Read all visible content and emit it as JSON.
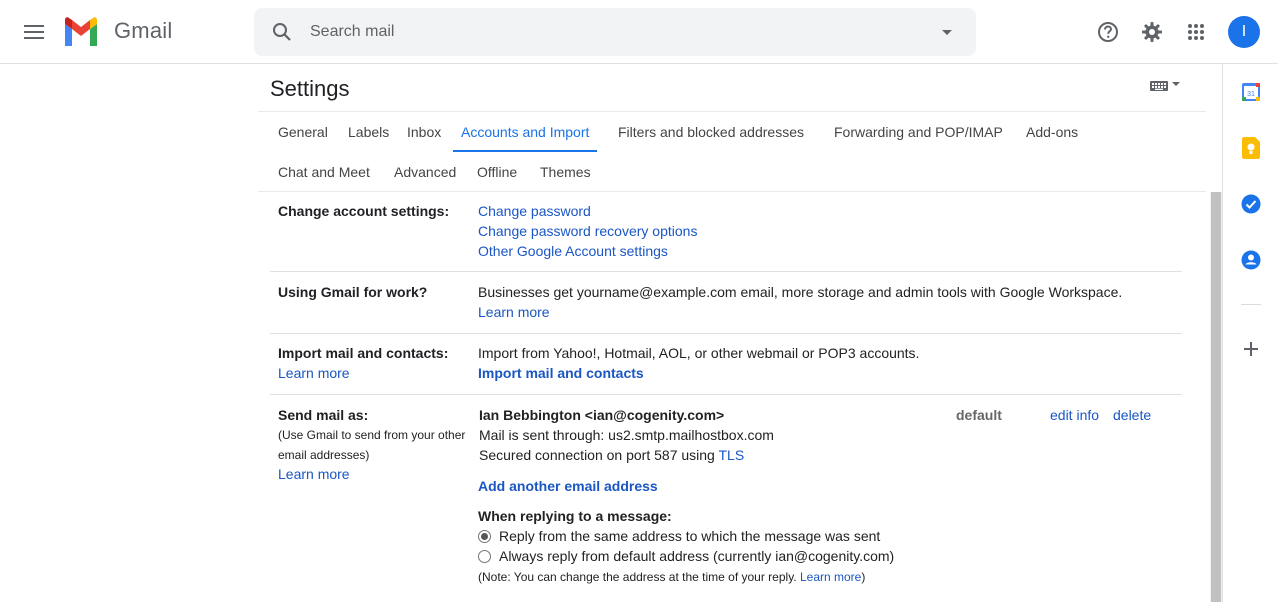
{
  "app": {
    "name": "Gmail"
  },
  "header": {
    "search_placeholder": "Search mail",
    "avatar_initial": "I"
  },
  "settings": {
    "title": "Settings",
    "tabs": [
      "General",
      "Labels",
      "Inbox",
      "Accounts and Import",
      "Filters and blocked addresses",
      "Forwarding and POP/IMAP",
      "Add-ons",
      "Chat and Meet",
      "Advanced",
      "Offline",
      "Themes"
    ],
    "active_tab": "Accounts and Import"
  },
  "sections": {
    "change_account": {
      "label": "Change account settings:",
      "links": [
        "Change password",
        "Change password recovery options",
        "Other Google Account settings"
      ]
    },
    "work": {
      "label": "Using Gmail for work?",
      "text": "Businesses get yourname@example.com email, more storage and admin tools with Google Workspace.",
      "link": "Learn more"
    },
    "import": {
      "label": "Import mail and contacts:",
      "label_link": "Learn more",
      "text": "Import from Yahoo!, Hotmail, AOL, or other webmail or POP3 accounts.",
      "action": "Import mail and contacts"
    },
    "send_as": {
      "label": "Send mail as:",
      "sub1": "(Use Gmail to send from your other",
      "sub2": "email addresses)",
      "label_link": "Learn more",
      "account_name": "Ian Bebbington <ian@cogenity.com>",
      "sent_through": "Mail is sent through: us2.smtp.mailhostbox.com",
      "secured_prefix": "Secured connection on port 587 using ",
      "secured_link": "TLS",
      "default_label": "default",
      "edit_info": "edit info",
      "delete": "delete",
      "add_another": "Add another email address",
      "reply_heading": "When replying to a message:",
      "reply_option_1": "Reply from the same address to which the message was sent",
      "reply_option_2": "Always reply from default address (currently ian@cogenity.com)",
      "note_prefix": "(Note: You can change the address at the time of your reply. ",
      "note_link": "Learn more",
      "note_suffix": ")"
    }
  },
  "icons": {
    "menu": "menu-icon",
    "search": "search-icon",
    "help": "help-icon",
    "settings": "gear-icon",
    "apps": "apps-grid-icon",
    "keyboard": "keyboard-icon",
    "calendar": "calendar-icon",
    "keep": "keep-icon",
    "tasks": "tasks-icon",
    "contacts": "contacts-icon",
    "add": "plus-icon"
  },
  "colors": {
    "accent": "#1a73e8",
    "link": "#1a56c4"
  }
}
